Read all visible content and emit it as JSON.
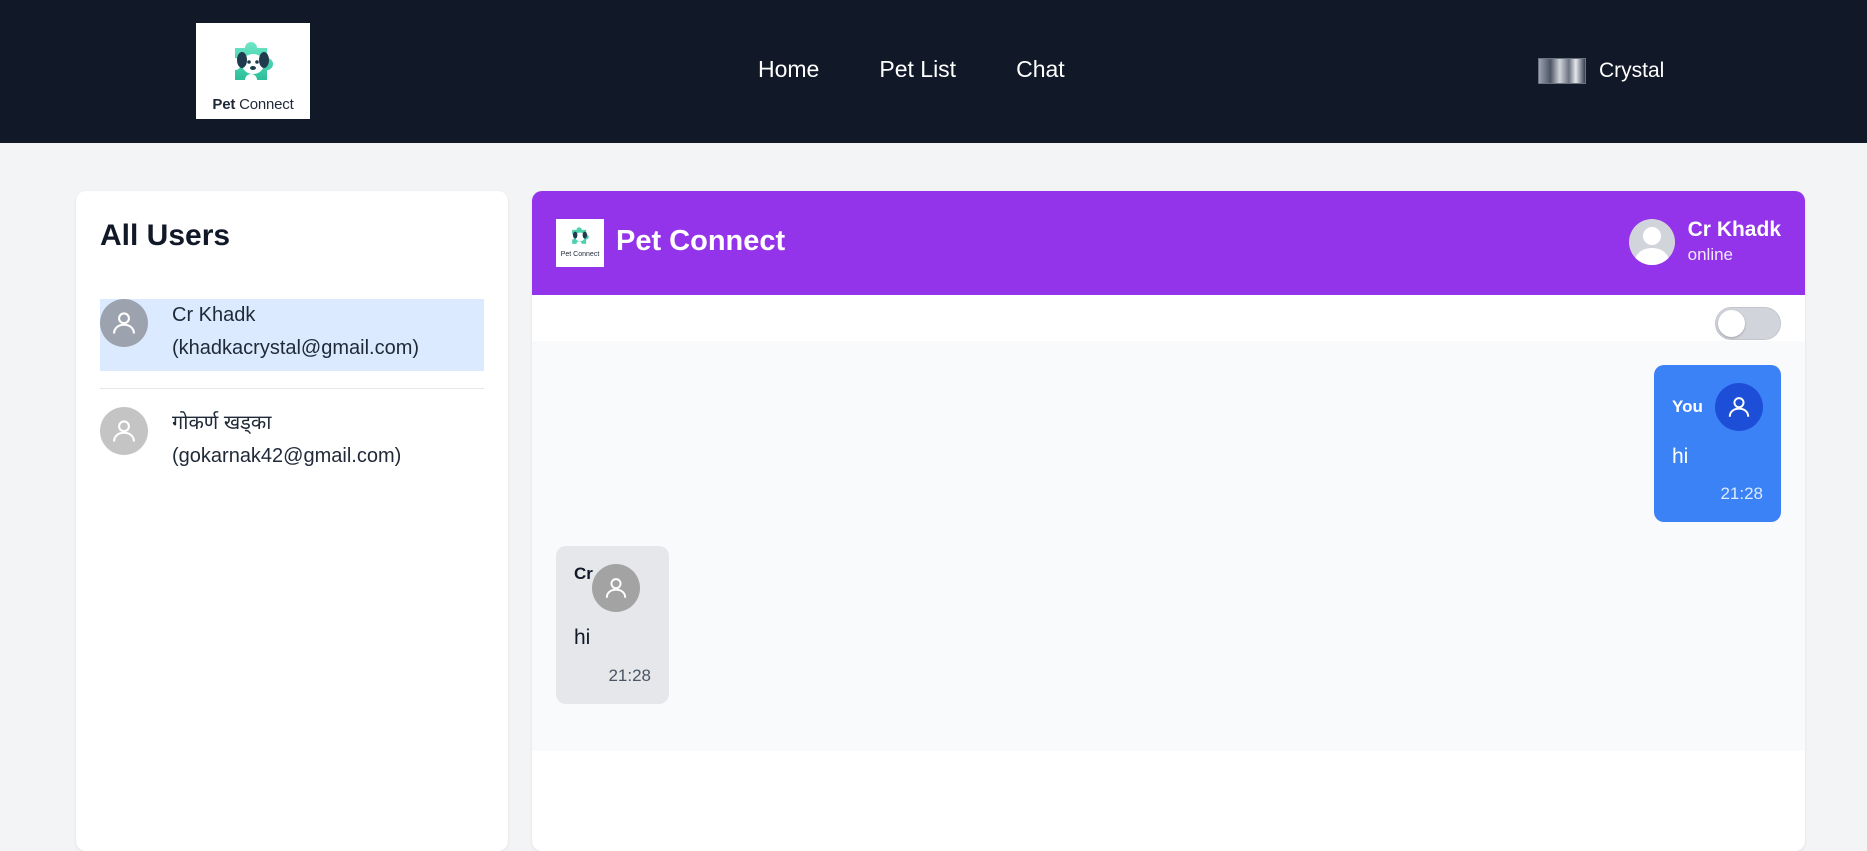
{
  "nav": {
    "logo_text_bold": "Pet",
    "logo_text": "Connect",
    "links": [
      "Home",
      "Pet List",
      "Chat"
    ],
    "username": "Crystal"
  },
  "users": {
    "title": "All Users",
    "items": [
      {
        "name": "Cr Khadk",
        "email": "(khadkacrystal@gmail.com)",
        "selected": true
      },
      {
        "name": "गोकर्ण खड्का",
        "email": "(gokarnak42@gmail.com)",
        "selected": false
      }
    ]
  },
  "chat": {
    "logo_text": "Pet Connect",
    "title": "Pet Connect",
    "contact_name": "Cr Khadk",
    "contact_status": "online",
    "toggle_on": false,
    "messages": [
      {
        "direction": "out",
        "sender": "You",
        "text": "hi",
        "time": "21:28"
      },
      {
        "direction": "in",
        "sender": "Cr",
        "text": "hi",
        "time": "21:28"
      }
    ]
  },
  "colors": {
    "nav_bg": "#111827",
    "page_bg": "#f3f4f6",
    "chat_header": "#9333ea",
    "bubble_out": "#3b82f6",
    "bubble_in": "#e5e7eb",
    "selected_user": "#dbeafe"
  },
  "icons": {
    "logo": "puppy-puzzle-logo-icon",
    "avatar": "user-silhouette-icon"
  }
}
